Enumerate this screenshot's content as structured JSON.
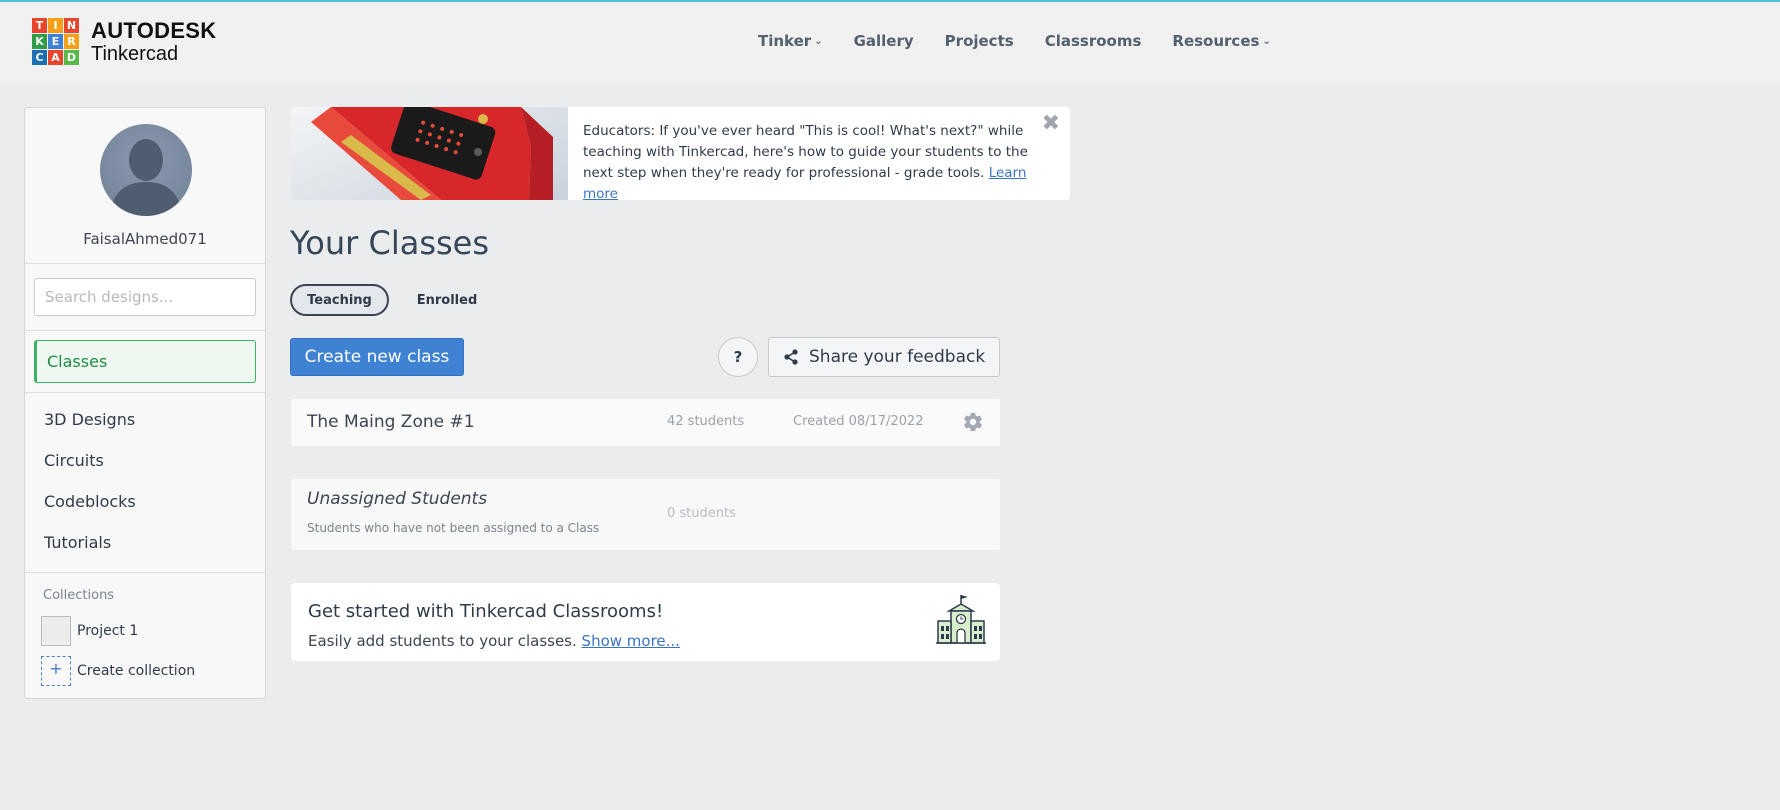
{
  "brand": {
    "logo_letters": [
      "T",
      "I",
      "N",
      "K",
      "E",
      "R",
      "C",
      "A",
      "D"
    ],
    "logo_colors": [
      "#e8452c",
      "#f6a01a",
      "#e8452c",
      "#2f9d47",
      "#3f82d4",
      "#f6a01a",
      "#1c6fb3",
      "#e8452c",
      "#58b848"
    ],
    "line1": "AUTODESK",
    "line2": "Tinkercad"
  },
  "nav": {
    "items": [
      {
        "label": "Tinker",
        "dropdown": true
      },
      {
        "label": "Gallery",
        "dropdown": false
      },
      {
        "label": "Projects",
        "dropdown": false
      },
      {
        "label": "Classrooms",
        "dropdown": false
      },
      {
        "label": "Resources",
        "dropdown": true
      }
    ]
  },
  "sidebar": {
    "username": "FaisalAhmed071",
    "search_placeholder": "Search designs...",
    "active_item": "Classes",
    "links": [
      "3D Designs",
      "Circuits",
      "Codeblocks",
      "Tutorials"
    ],
    "collections_title": "Collections",
    "collections": [
      "Project 1"
    ],
    "create_collection": "Create collection"
  },
  "banner": {
    "text": "Educators: If you've ever heard \"This is cool! What's next?\" while teaching with Tinkercad, here's how to guide your students to the next step when they're ready for professional - grade tools.",
    "link": "Learn more",
    "close": "✖"
  },
  "main": {
    "title": "Your Classes",
    "tabs": {
      "teaching": "Teaching",
      "enrolled": "Enrolled"
    },
    "create_button": "Create new class",
    "help": "?",
    "feedback_button": "Share your feedback",
    "classes": [
      {
        "name": "The Maing Zone #1",
        "students": "42 students",
        "created": "Created 08/17/2022"
      }
    ],
    "unassigned": {
      "title": "Unassigned Students",
      "description": "Students who have not been assigned to a Class",
      "count": "0 students"
    },
    "get_started": {
      "title": "Get started with Tinkercad Classrooms!",
      "description": "Easily add students to your classes.",
      "link": "Show more..."
    }
  },
  "colors": {
    "accent_blue": "#3f82d4",
    "active_green": "#3bb365",
    "header_bg": "#f1f1f1"
  }
}
